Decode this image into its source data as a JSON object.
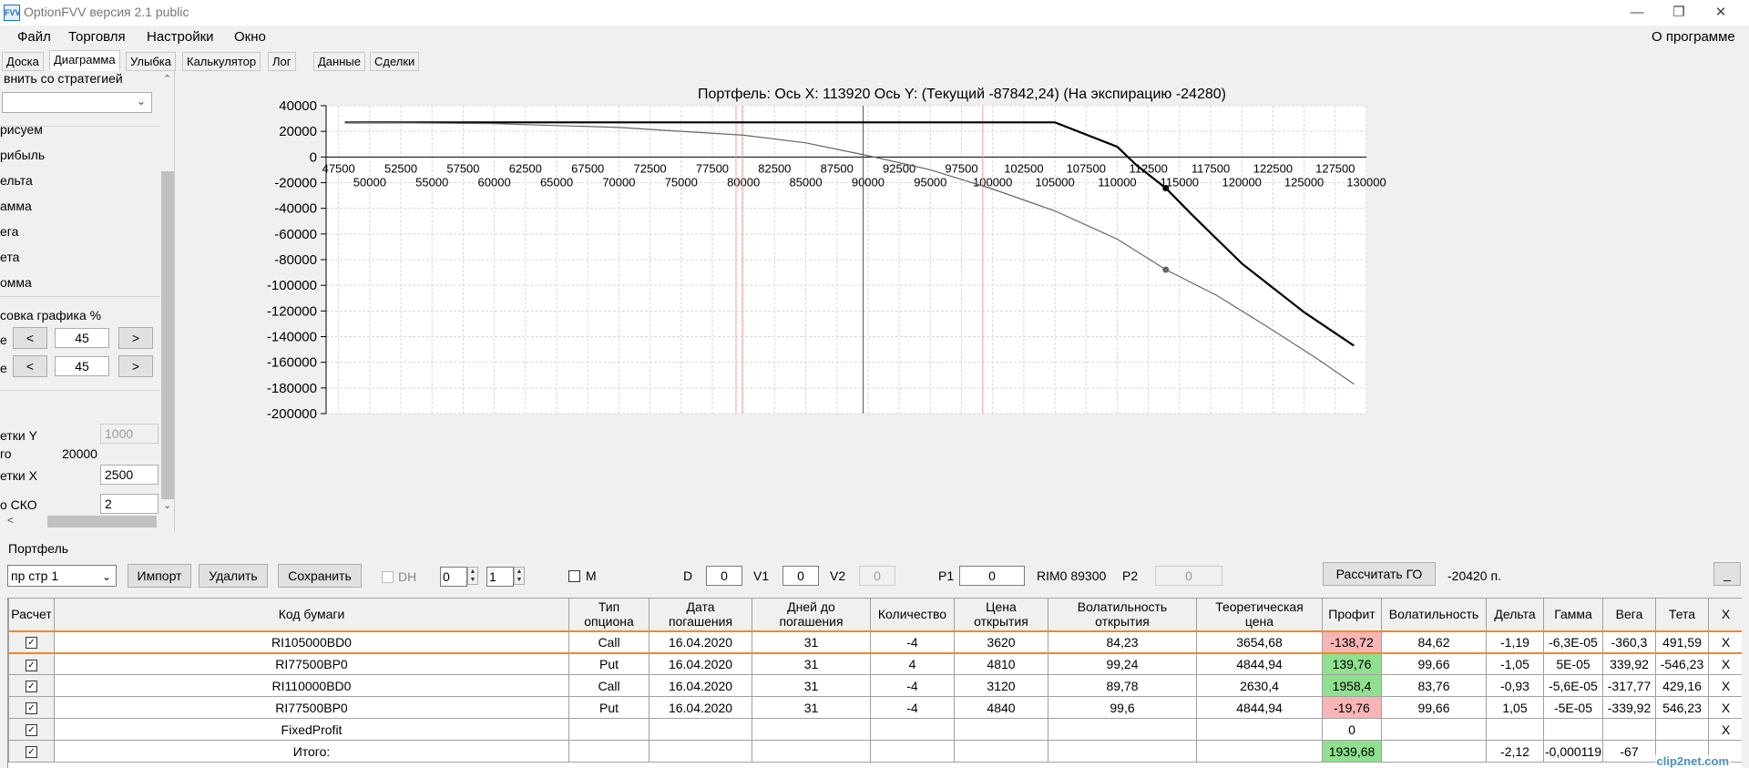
{
  "window": {
    "title": "OptionFVV версия 2.1 public",
    "icon": "app-icon",
    "icon_text": "FVV",
    "minimize_glyph": "—",
    "maximize_glyph": "❐",
    "close_glyph": "✕"
  },
  "menu": {
    "items": [
      "Файл",
      "Торговля",
      "Настройки",
      "Окно"
    ],
    "about": "О программе"
  },
  "tabs": [
    "Доска",
    "Диаграмма",
    "Улыбка",
    "Калькулятор",
    "Лог",
    "Данные",
    "Сделки"
  ],
  "active_tab": "Диаграмма",
  "left_panel": {
    "compare_label": "внить со стратегией",
    "checks": [
      "рисуем",
      "рибыль",
      "ельта",
      "амма",
      "ега",
      "ета",
      "омма"
    ],
    "scale_label": "совка графика %",
    "row1": {
      "label": "е",
      "dec": "<",
      "value": "45",
      "inc": ">"
    },
    "row2": {
      "label": "е",
      "dec": "<",
      "value": "45",
      "inc": ">"
    },
    "grid_y_label": "етки Y",
    "grid_y_value": "1000",
    "total_label": "го",
    "total_value": "20000",
    "grid_x_label": "етки X",
    "grid_x_value": "2500",
    "sko_label": "о СКО",
    "sko_value": "2",
    "scroll_up": "⌃",
    "scroll_down": "⌄",
    "scroll_left": "<"
  },
  "chart_title": "Портфель: Ось X: 113920 Ось Y:  (Текущий -87842,24)  (На экспирацию -24280)",
  "chart_data": {
    "type": "line",
    "y_ticks": [
      "40000",
      "20000",
      "0",
      "-20000",
      "-40000",
      "-60000",
      "-80000",
      "-100000",
      "-120000",
      "-140000",
      "-160000",
      "-180000",
      "-200000"
    ],
    "x_ticks_upper": [
      "47500",
      "52500",
      "57500",
      "62500",
      "67500",
      "72500",
      "77500",
      "82500",
      "87500",
      "92500",
      "97500",
      "102500",
      "107500",
      "112500",
      "117500",
      "122500",
      "127500"
    ],
    "x_ticks_lower": [
      "50000",
      "55000",
      "60000",
      "65000",
      "70000",
      "75000",
      "80000",
      "85000",
      "90000",
      "95000",
      "100000",
      "105000",
      "110000",
      "115000",
      "120000",
      "125000",
      "130000"
    ],
    "xlim": [
      46500,
      130000
    ],
    "ylim": [
      -200000,
      40000
    ],
    "grid": true,
    "vertical_markers": [
      {
        "x": 79400,
        "color": "#f4a0a0"
      },
      {
        "x": 79900,
        "color": "#f4a0a0"
      },
      {
        "x": 89600,
        "color": "#555555"
      },
      {
        "x": 99200,
        "color": "#f4a0a0"
      }
    ],
    "series": [
      {
        "color": "#000000",
        "x": [
          48000,
          60000,
          70000,
          80000,
          90000,
          100000,
          105000,
          110000,
          111500,
          113900,
          116000,
          120000,
          125000,
          129000
        ],
        "y": [
          27000,
          27000,
          27000,
          27000,
          27000,
          27000,
          27000,
          8000,
          -6000,
          -24280,
          -45000,
          -83000,
          -121000,
          -147000
        ],
        "marker": {
          "x": 113900,
          "y": -24280
        }
      },
      {
        "color": "#666666",
        "x": [
          48000,
          60000,
          70000,
          80000,
          85000,
          90000,
          95000,
          100000,
          105000,
          110000,
          113900,
          118000,
          122000,
          126000,
          129000
        ],
        "y": [
          27000,
          26000,
          23000,
          17000,
          11000,
          1000,
          -10000,
          -25000,
          -42000,
          -64000,
          -87842,
          -108000,
          -132000,
          -157000,
          -177000
        ],
        "marker": {
          "x": 113900,
          "y": -87842
        }
      }
    ]
  },
  "portfolio": {
    "label": "Портфель",
    "strategy_combo": "пр стр 1",
    "import_btn": "Импорт",
    "delete_btn": "Удалить",
    "save_btn": "Сохранить",
    "dh_label": "DH",
    "spin1": "0",
    "spin2": "1",
    "m_label": "M",
    "d_label": "D",
    "d_value": "0",
    "v1_label": "V1",
    "v1_value": "0",
    "v2_label": "V2",
    "v2_value": "0",
    "p1_label": "P1",
    "p1_value": "0",
    "rim_label": "RIM0 89300",
    "p2_label": "P2",
    "p2_value": "0",
    "calc_go_btn": "Рассчитать ГО",
    "go_value": "-20420 п.",
    "collapse_btn": "_"
  },
  "table": {
    "headers": [
      "Расчет",
      "Код бумаги",
      "Тип\nопциона",
      "Дата\nпогашения",
      "Дней до\nпогашения",
      "Количество",
      "Цена\nоткрытия",
      "Волатильность\nоткрытия",
      "Теоретическая\nцена",
      "Профит",
      "Волатильность",
      "Дельта",
      "Гамма",
      "Вега",
      "Тета",
      "X"
    ],
    "rows": [
      {
        "code": "RI105000BD0",
        "type": "Call",
        "date": "16.04.2020",
        "days": "31",
        "qty": "-4",
        "price": "3620",
        "vol_open": "84,23",
        "theo": "3654,68",
        "profit": "-138,72",
        "profit_class": "neg",
        "vol": "84,62",
        "delta": "-1,19",
        "gamma": "-6,3E-05",
        "vega": "-360,3",
        "theta": "491,59",
        "x": "X"
      },
      {
        "code": "RI77500BP0",
        "type": "Put",
        "date": "16.04.2020",
        "days": "31",
        "qty": "4",
        "price": "4810",
        "vol_open": "99,24",
        "theo": "4844,94",
        "profit": "139,76",
        "profit_class": "pos",
        "vol": "99,66",
        "delta": "-1,05",
        "gamma": "5E-05",
        "vega": "339,92",
        "theta": "-546,23",
        "x": "X"
      },
      {
        "code": "RI110000BD0",
        "type": "Call",
        "date": "16.04.2020",
        "days": "31",
        "qty": "-4",
        "price": "3120",
        "vol_open": "89,78",
        "theo": "2630,4",
        "profit": "1958,4",
        "profit_class": "pos",
        "vol": "83,76",
        "delta": "-0,93",
        "gamma": "-5,6E-05",
        "vega": "-317,77",
        "theta": "429,16",
        "x": "X"
      },
      {
        "code": "RI77500BP0",
        "type": "Put",
        "date": "16.04.2020",
        "days": "31",
        "qty": "-4",
        "price": "4840",
        "vol_open": "99,6",
        "theo": "4844,94",
        "profit": "-19,76",
        "profit_class": "neg",
        "vol": "99,66",
        "delta": "1,05",
        "gamma": "-5E-05",
        "vega": "-339,92",
        "theta": "546,23",
        "x": "X"
      },
      {
        "code": "FixedProfit",
        "type": "",
        "date": "",
        "days": "",
        "qty": "",
        "price": "",
        "vol_open": "",
        "theo": "",
        "profit": "0",
        "profit_class": "",
        "vol": "",
        "delta": "",
        "gamma": "",
        "vega": "",
        "theta": "",
        "x": "X"
      }
    ],
    "total": {
      "code": "Итого:",
      "profit": "1939,68",
      "delta": "-2,12",
      "gamma": "-0,000119",
      "vega": "-67",
      "theta": ""
    }
  },
  "watermark": "clip2net.com"
}
